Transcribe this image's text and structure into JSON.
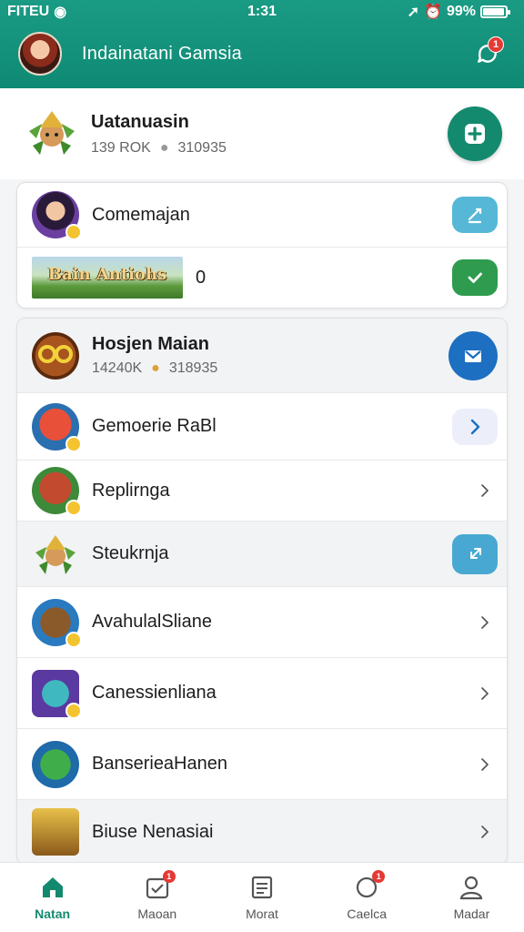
{
  "status_bar": {
    "carrier": "FITEU",
    "time": "1:31",
    "battery": "99%"
  },
  "header": {
    "title": "Indainatani Gamsia",
    "notification_count": "1"
  },
  "hero": {
    "name": "Uatanuasin",
    "stat_primary": "139 ROK",
    "stat_secondary": "310935"
  },
  "card_top": {
    "rows": [
      {
        "label": "Comemajan"
      },
      {
        "banner_text": "Bain Antiohs",
        "value": "0"
      }
    ]
  },
  "card_main": {
    "featured": {
      "name": "Hosjen Maian",
      "stat_primary": "14240K",
      "stat_secondary": "318935"
    },
    "items": [
      {
        "label": "Gemoerie RaBl"
      },
      {
        "label": "Replirnga"
      },
      {
        "label": "Steukrnja"
      },
      {
        "label": "AvahulalSliane"
      },
      {
        "label": "Canessienliana"
      },
      {
        "label": "BanserieaHanen"
      },
      {
        "label": "Biuse Nenasiai"
      }
    ]
  },
  "bottom_nav": [
    {
      "label": "Natan",
      "icon": "home-icon",
      "active": true
    },
    {
      "label": "Maoan",
      "icon": "inbox-icon",
      "badge": "1"
    },
    {
      "label": "Morat",
      "icon": "document-icon"
    },
    {
      "label": "Caelca",
      "icon": "chat-icon",
      "badge": "1"
    },
    {
      "label": "Madar",
      "icon": "profile-icon"
    }
  ],
  "colors": {
    "header_bg": "#138a6e",
    "accent_green": "#138a6e",
    "light_blue": "#56b8d6",
    "confirm_green": "#2e9b4f",
    "mail_blue": "#1c6fc1",
    "badge_red": "#e53935"
  }
}
